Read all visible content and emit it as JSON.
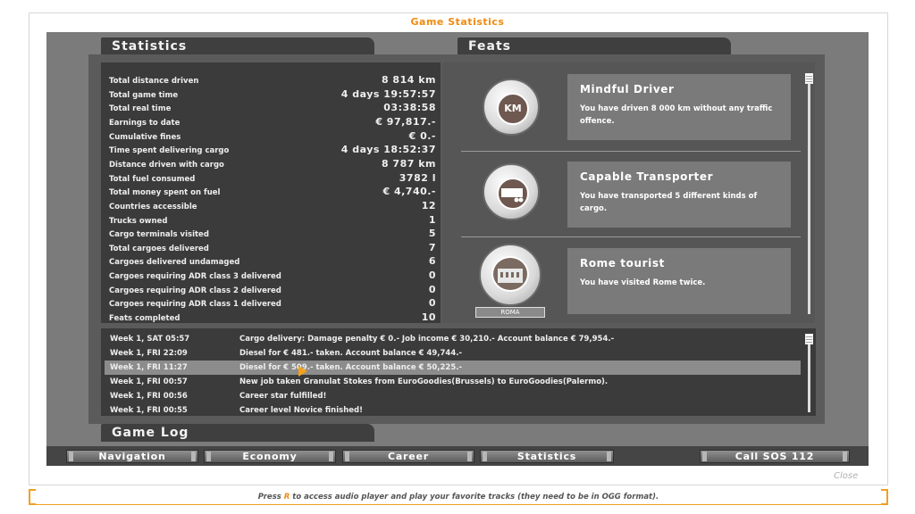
{
  "window": {
    "title": "Game Statistics",
    "close_label": "Close"
  },
  "statistics": {
    "header": "Statistics",
    "rows": [
      {
        "label": "Total distance driven",
        "value": "8 814 km"
      },
      {
        "label": "Total game time",
        "value": "4 days 19:57:57"
      },
      {
        "label": "Total real time",
        "value": "03:38:58"
      },
      {
        "label": "Earnings to date",
        "value": "€ 97,817.-"
      },
      {
        "label": "Cumulative fines",
        "value": "€ 0.-"
      },
      {
        "label": "Time spent delivering cargo",
        "value": "4 days 18:52:37"
      },
      {
        "label": "Distance driven with cargo",
        "value": "8 787 km"
      },
      {
        "label": "Total fuel consumed",
        "value": "3782 l"
      },
      {
        "label": "Total money spent on fuel",
        "value": "€ 4,740.-"
      },
      {
        "label": "Countries accessible",
        "value": "12"
      },
      {
        "label": "Trucks owned",
        "value": "1"
      },
      {
        "label": "Cargo terminals visited",
        "value": "5"
      },
      {
        "label": "Total cargoes delivered",
        "value": "7"
      },
      {
        "label": "Cargoes delivered undamaged",
        "value": "6"
      },
      {
        "label": "Cargoes requiring ADR class 3 delivered",
        "value": "0"
      },
      {
        "label": "Cargoes requiring ADR class 2 delivered",
        "value": "0"
      },
      {
        "label": "Cargoes requiring ADR class 1 delivered",
        "value": "0"
      },
      {
        "label": "Feats completed",
        "value": "10"
      }
    ]
  },
  "feats": {
    "header": "Feats",
    "items": [
      {
        "title": "Mindful Driver",
        "desc": "You have driven 8 000 km without any traffic offence.",
        "badge": "KM",
        "icon": "laurel-km-icon"
      },
      {
        "title": "Capable Transporter",
        "desc": "You have transported 5 different kinds of cargo.",
        "badge": "",
        "icon": "trailer-icon"
      },
      {
        "title": "Rome tourist",
        "desc": "You have visited Rome twice.",
        "badge": "",
        "icon": "colosseum-icon",
        "plaque": "ROMA"
      }
    ]
  },
  "game_log": {
    "header": "Game Log",
    "entries": [
      {
        "time": "Week 1, SAT 05:57",
        "msg": "Cargo delivery: Damage penalty € 0.- Job income € 30,210.- Account balance € 79,954.-"
      },
      {
        "time": "Week 1, FRI 22:09",
        "msg": "Diesel for € 481.- taken. Account balance € 49,744.-"
      },
      {
        "time": "Week 1, FRI 11:27",
        "msg": "Diesel for € 509.- taken. Account balance € 50,225.-",
        "selected": true
      },
      {
        "time": "Week 1, FRI 00:57",
        "msg": "New job taken Granulat Stokes from EuroGoodies(Brussels) to EuroGoodies(Palermo)."
      },
      {
        "time": "Week 1, FRI 00:56",
        "msg": "Career star fulfilled!"
      },
      {
        "time": "Week 1, FRI 00:55",
        "msg": "Career level Novice finished!"
      }
    ]
  },
  "nav": {
    "buttons": [
      "Navigation",
      "Economy",
      "Career",
      "Statistics"
    ],
    "sos": "Call SOS 112"
  },
  "footer": {
    "before": "Press ",
    "key": "R",
    "after": " to access audio player and play your favorite tracks (they need to be in OGG format)."
  },
  "colors": {
    "accent": "#f08a10",
    "panel": "#7b7b7b",
    "dark": "#3b3b3b"
  }
}
